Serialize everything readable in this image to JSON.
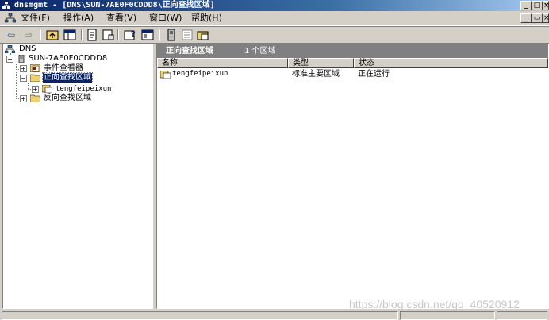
{
  "window": {
    "title": "dnsmgmt - [DNS\\SUN-7AE0F0CDDD8\\正向查找区域]",
    "controls": [
      "_",
      "□",
      "×"
    ]
  },
  "menu": {
    "items": [
      "文件(F)",
      "操作(A)",
      "查看(V)",
      "窗口(W)",
      "帮助(H)"
    ],
    "mdi_controls": [
      "_",
      "▭",
      "×"
    ]
  },
  "toolbar": {
    "buttons": [
      "back-icon",
      "forward-icon",
      "up-folder-icon",
      "show-tree-icon",
      "export-icon",
      "properties-icon",
      "help-icon",
      "console-icon",
      "server-icon",
      "list-icon",
      "zone-icon"
    ]
  },
  "tree": {
    "items": [
      {
        "label": "DNS",
        "icon": "dns-icon"
      },
      {
        "label": "SUN-7AE0F0CDDD8",
        "icon": "server-icon"
      },
      {
        "label": "事件查看器",
        "icon": "event-viewer-icon"
      },
      {
        "label": "正向查找区域",
        "icon": "folder-icon",
        "selected": true
      },
      {
        "label": "tengfeipeixun",
        "icon": "zone-icon"
      },
      {
        "label": "反向查找区域",
        "icon": "folder-icon"
      }
    ]
  },
  "details": {
    "title": "正向查找区域",
    "count": "1 个区域",
    "columns": [
      "名称",
      "类型",
      "状态"
    ],
    "rows": [
      {
        "name": "tengfeipeixun",
        "type": "标准主要区域",
        "status": "正在运行"
      }
    ]
  },
  "watermark": "https://blog.csdn.net/qq_40520912"
}
